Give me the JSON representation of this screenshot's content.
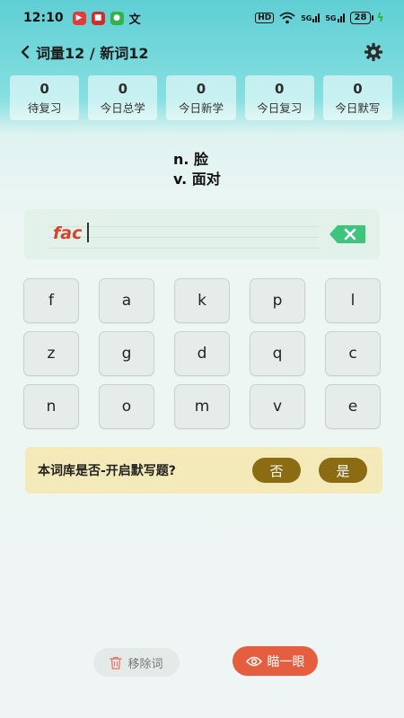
{
  "status": {
    "time": "12:10",
    "translate_glyph": "文",
    "hd": "HD",
    "battery": "28",
    "signal1": "5G",
    "signal2": "5G"
  },
  "nav": {
    "title": "词量12 / 新词12"
  },
  "stats": [
    {
      "value": "0",
      "label": "待复习"
    },
    {
      "value": "0",
      "label": "今日总学"
    },
    {
      "value": "0",
      "label": "今日新学"
    },
    {
      "value": "0",
      "label": "今日复习"
    },
    {
      "value": "0",
      "label": "今日默写"
    }
  ],
  "definition": {
    "line1": "n. 脸",
    "line2": "v. 面对"
  },
  "input": {
    "typed": "fac"
  },
  "keyboard": {
    "rows": [
      [
        "f",
        "a",
        "k",
        "p",
        "l"
      ],
      [
        "z",
        "g",
        "d",
        "q",
        "c"
      ],
      [
        "n",
        "o",
        "m",
        "v",
        "e"
      ]
    ]
  },
  "prompt": {
    "text": "本词库是否-开启默写题?",
    "no": "否",
    "yes": "是"
  },
  "actions": {
    "remove": "移除词",
    "peek": "瞄一眼"
  },
  "colors": {
    "accent": "#e45e3f",
    "prompt_button": "#8b6c13",
    "typed": "#d3452a",
    "backspace": "#3fc47e"
  }
}
